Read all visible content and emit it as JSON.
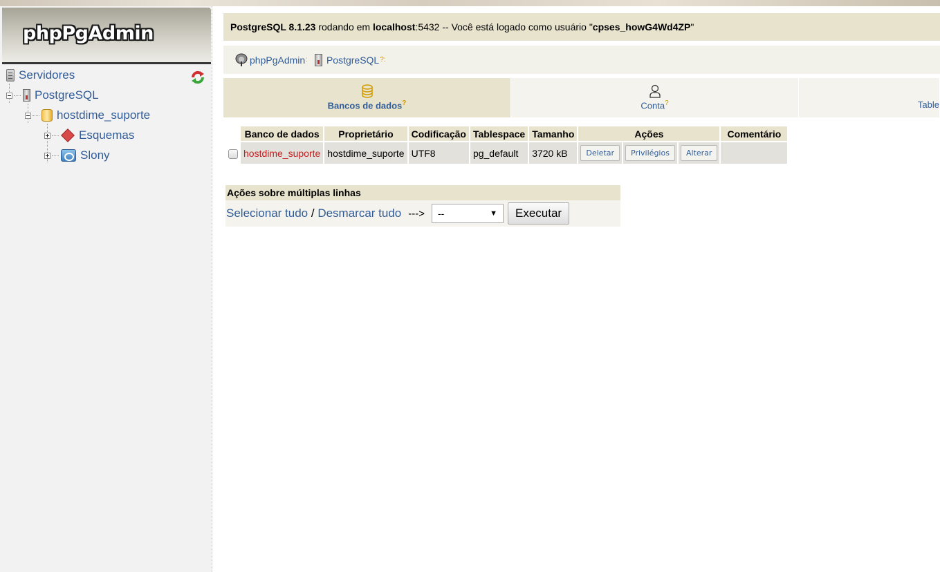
{
  "sidebar": {
    "logo_text": "phpPgAdmin",
    "tree": {
      "servers": "Servidores",
      "postgres": "PostgreSQL",
      "database": "hostdime_suporte",
      "schemas": "Esquemas",
      "slony": "Slony"
    }
  },
  "infobar": {
    "server_name": "PostgreSQL 8.1.23",
    "running_on": " rodando em ",
    "host": "localhost",
    "port_text": ":5432 -- Você está logado como usuário \"",
    "user": "cpses_howG4Wd4ZP",
    "end_quote": "\""
  },
  "breadcrumb": {
    "app": "phpPgAdmin",
    "server": "PostgreSQL",
    "app_help": ":",
    "server_help": "?:"
  },
  "tabs": [
    {
      "label": "Bancos de dados",
      "help": "?",
      "icon": "database-icon"
    },
    {
      "label": "Conta",
      "help": "?",
      "icon": "user-icon"
    },
    {
      "label": "Table",
      "help": "",
      "icon": ""
    }
  ],
  "table": {
    "headers": [
      "Banco de dados",
      "Proprietário",
      "Codificação",
      "Tablespace",
      "Tamanho",
      "Ações",
      "Comentário"
    ],
    "rows": [
      {
        "name": "hostdime_suporte",
        "owner": "hostdime_suporte",
        "encoding": "UTF8",
        "tablespace": "pg_default",
        "size": "3720 kB",
        "actions": [
          "Deletar",
          "Privilégios",
          "Alterar"
        ],
        "comment": ""
      }
    ]
  },
  "multi": {
    "title": "Ações sobre múltiplas linhas",
    "select_all": "Selecionar tudo",
    "separator": " / ",
    "deselect_all": "Desmarcar tudo",
    "arrow": "--->",
    "select_value": "--",
    "execute": "Executar"
  },
  "colors": {
    "accent_bg": "#e8e3cc",
    "link": "#2f5c98",
    "db_link": "#c62020"
  }
}
